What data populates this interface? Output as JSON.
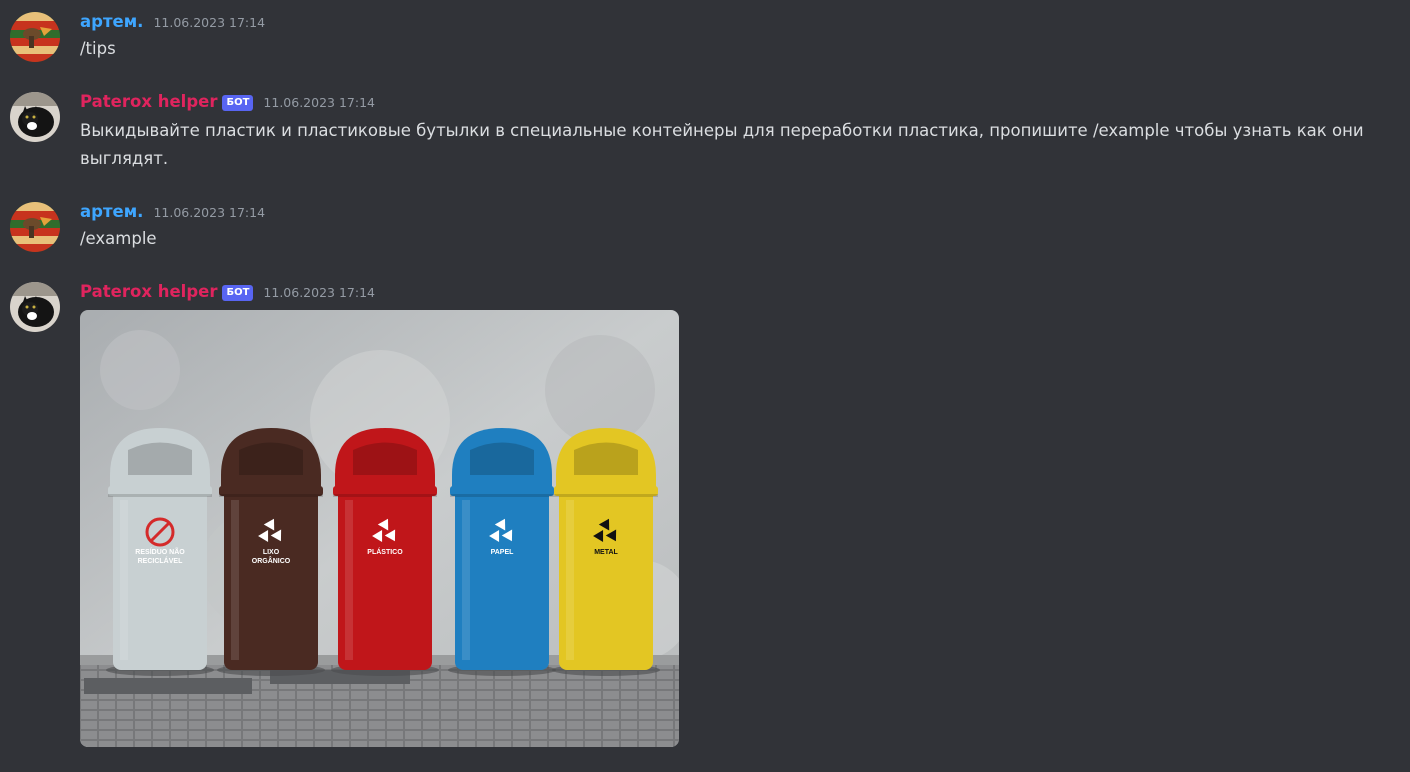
{
  "messages": [
    {
      "author": "артем.",
      "timestamp": "11.06.2023 17:14",
      "text": "/tips"
    },
    {
      "author": "Paterox helper",
      "badge": "БОТ",
      "timestamp": "11.06.2023 17:14",
      "text": "Выкидывайте пластик и пластиковые бутылки в специальные контейнеры для переработки пластика, пропишите /example чтобы узнать как они выглядят."
    },
    {
      "author": "артем.",
      "timestamp": "11.06.2023 17:14",
      "text": "/example"
    },
    {
      "author": "Paterox helper",
      "badge": "БОТ",
      "timestamp": "11.06.2023 17:14",
      "image": {
        "bin_labels": [
          {
            "line1": "RESÍDUO NÃO",
            "line2": "RECICLÁVEL"
          },
          {
            "line1": "LIXO",
            "line2": "ORGÂNICO"
          },
          {
            "line1": "PLÁSTICO",
            "line2": ""
          },
          {
            "line1": "PAPEL",
            "line2": ""
          },
          {
            "line1": "METAL",
            "line2": ""
          }
        ]
      }
    }
  ],
  "colors": {
    "background": "#313338",
    "user_name": "#3ea6ff",
    "bot_name": "#e0245e",
    "badge": "#5865f2",
    "timestamp": "#949ba4",
    "bins": [
      "#c8d0d2",
      "#4a2a22",
      "#c0161a",
      "#1f7fc0",
      "#e3c623"
    ]
  }
}
